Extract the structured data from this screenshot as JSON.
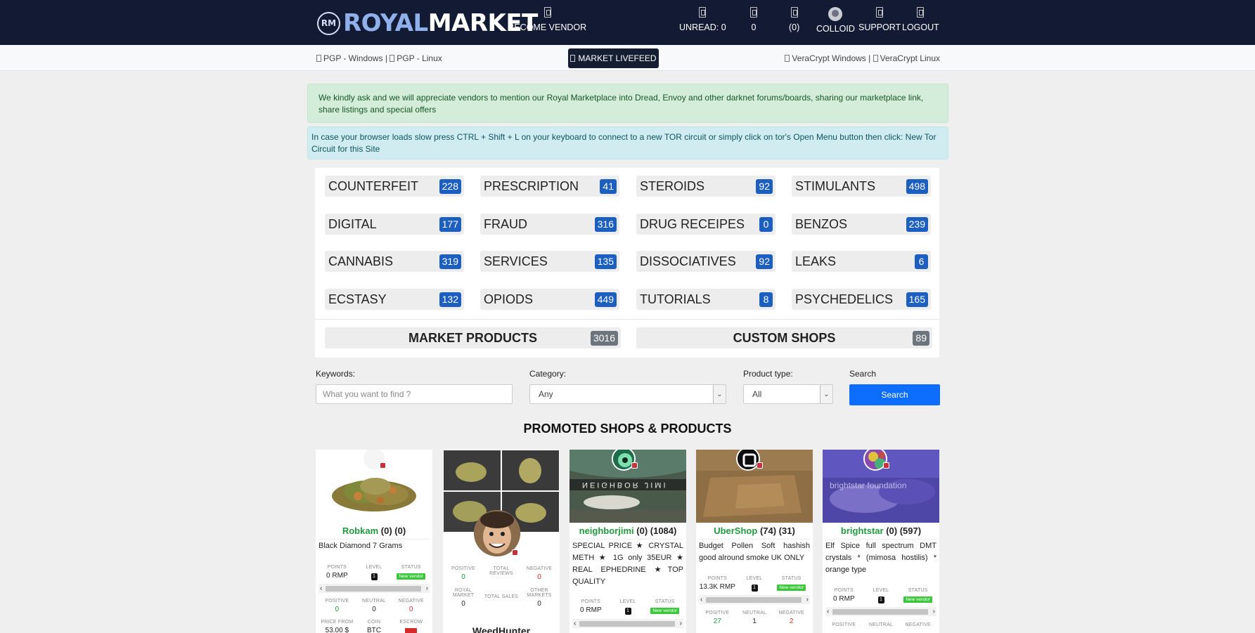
{
  "brand": {
    "badge": "RM",
    "royal": "ROYAL",
    "market": "MARKET"
  },
  "nav": {
    "become_vendor": "BECOME VENDOR",
    "unread": "UNREAD: 0",
    "count_a": "0",
    "count_b": "(0)",
    "user": "COLLOID",
    "support": "SUPPORT",
    "logout": "LOGOUT"
  },
  "subnav": {
    "pgp_windows": "PGP - Windows",
    "sep1": "|",
    "pgp_linux": "PGP - Linux",
    "livefeed": "MARKET LIVEFEED",
    "veracrypt_windows": "VeraCrypt Windows",
    "sep2": "|",
    "veracrypt_linux": "VeraCrypt Linux"
  },
  "alerts": {
    "vendors": "We kindly ask and we will appreciate vendors to mention our Royal Marketplace into Dread, Envoy and other darknet forums/boards, sharing our marketplace link, share listings and special offers",
    "tor": "In case your browser loads slow press CTRL + Shift + L on your keyboard to connect to a new TOR circuit or simply click on tor's Open Menu button then click: New Tor Circuit for this Site"
  },
  "categories": [
    {
      "name": "COUNTERFEIT",
      "count": "228"
    },
    {
      "name": "PRESCRIPTION",
      "count": "41"
    },
    {
      "name": "STEROIDS",
      "count": "92"
    },
    {
      "name": "STIMULANTS",
      "count": "498"
    },
    {
      "name": "DIGITAL",
      "count": "177"
    },
    {
      "name": "FRAUD",
      "count": "316"
    },
    {
      "name": "DRUG RECEIPES",
      "count": "0"
    },
    {
      "name": "BENZOS",
      "count": "239"
    },
    {
      "name": "CANNABIS",
      "count": "319"
    },
    {
      "name": "SERVICES",
      "count": "135"
    },
    {
      "name": "DISSOCIATIVES",
      "count": "92"
    },
    {
      "name": "LEAKS",
      "count": "6"
    },
    {
      "name": "ECSTASY",
      "count": "132"
    },
    {
      "name": "OPIODS",
      "count": "449"
    },
    {
      "name": "TUTORIALS",
      "count": "8"
    },
    {
      "name": "PSYCHEDELICS",
      "count": "165"
    }
  ],
  "big_categories": [
    {
      "name": "MARKET PRODUCTS",
      "count": "3016"
    },
    {
      "name": "CUSTOM SHOPS",
      "count": "89"
    }
  ],
  "search": {
    "keywords_label": "Keywords:",
    "keywords_placeholder": "What you want to find ?",
    "category_label": "Category:",
    "category_value": "Any",
    "type_label": "Product type:",
    "type_value": "All",
    "search_label": "Search",
    "button": "Search"
  },
  "promoted_title": "PROMOTED SHOPS & PRODUCTS",
  "labels": {
    "points": "POINTS",
    "level": "LEVEL",
    "status": "STATUS",
    "positive": "POSITIVE",
    "neutral": "NEUTRAL",
    "negative": "NEGATIVE",
    "price_from": "PRICE FROM",
    "coin": "COIN",
    "escrow": "ESCROW",
    "total_reviews": "TOTAL REVIEWS",
    "royal_market": "ROYAL MARKET",
    "total_sales": "TOTAL SALES",
    "other_markets": "OTHER MARKETS",
    "new_vendor": "New vendor"
  },
  "cards": [
    {
      "seller": "Robkam",
      "stats": "(0) (0)",
      "title": "Black Diamond 7 Grams",
      "points": "0 RMP",
      "level": "1",
      "positive": "0",
      "neutral": "0",
      "negative": "0",
      "price_from": "53.00 $",
      "coin": "BTC"
    },
    {
      "positive": "0",
      "total_reviews": "",
      "negative": "0",
      "royal_market": "0",
      "total_sales": "",
      "other_markets": "0",
      "shop_name": "WeedHunter",
      "img_caption": "WeedHunter"
    },
    {
      "seller": "neighborjimi",
      "stats": "(0) (1084)",
      "title": "SPECIAL PRICE ★ CRYSTAL METH ★ 1G only 35EUR ★ REAL EPHEDRINE ★TOP QUALITY",
      "points": "0 RMP",
      "level": "1",
      "banner": "NEIGHBOR JIMI"
    },
    {
      "seller": "UberShop",
      "stats": "(74) (31)",
      "title": "Budget Pollen Soft hashish good alround smoke UK ONLY",
      "points": "13.3K RMP",
      "level": "1",
      "positive": "27",
      "neutral": "1",
      "negative": "2"
    },
    {
      "seller": "brightstar",
      "stats": "(0) (597)",
      "title": "Elf Spice full spectrum DMT crystals * (mimosa hostilis) * orange type",
      "points": "0 RMP",
      "level": "1",
      "banner": "brightstar foundation"
    }
  ]
}
